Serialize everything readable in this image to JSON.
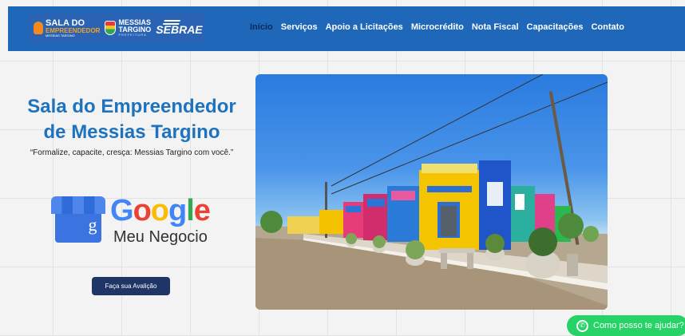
{
  "header": {
    "logos": {
      "sala": {
        "line1": "SALA DO",
        "line2": "EMPREENDEDOR",
        "line3": "MESSIAS TARGINO"
      },
      "messias": {
        "line1": "MESSIAS",
        "line2": "TARGINO",
        "line3": "PREFEITURA"
      },
      "sebrae": "SEBRAE"
    },
    "nav": [
      {
        "label": "Início"
      },
      {
        "label": "Serviços"
      },
      {
        "label": "Apoio a Licitações"
      },
      {
        "label": "Microcrédito"
      },
      {
        "label": "Nota Fiscal"
      },
      {
        "label": "Capacitações"
      },
      {
        "label": "Contato"
      }
    ],
    "active_index": 0
  },
  "hero": {
    "title_line1": "Sala do Empreendedor",
    "title_line2": "de Messias Targino",
    "tagline": "“Formalize, capacite, cresça: Messias Targino com você.”",
    "gmb": {
      "word": "Google",
      "subtitle": "Meu Negocio",
      "store_letter": "g"
    },
    "review_button": "Faça sua Avalição"
  },
  "whatsapp": {
    "label": "Como posso te ajudar?"
  },
  "colors": {
    "header_bg": "#1f67b8",
    "title": "#1e73be",
    "button_bg": "#1e3566",
    "whatsapp": "#25d366"
  }
}
